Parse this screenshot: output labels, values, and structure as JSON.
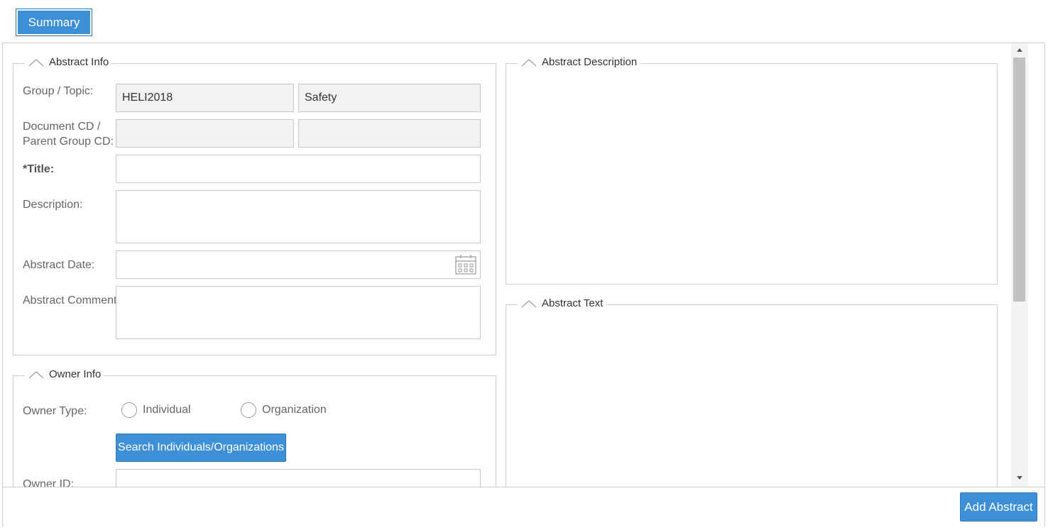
{
  "tabs": {
    "summary": "Summary"
  },
  "abstract_info": {
    "legend": "Abstract Info",
    "group_topic_label": "Group / Topic:",
    "group_value": "HELI2018",
    "topic_value": "Safety",
    "doc_cd_label_1": "Document CD /",
    "doc_cd_label_2": "Parent Group CD:",
    "document_cd_value": "",
    "parent_group_cd_value": "",
    "title_label": "*Title:",
    "title_value": "",
    "description_label": "Description:",
    "description_value": "",
    "abstract_date_label": "Abstract Date:",
    "abstract_date_value": "",
    "abstract_comment_label": "Abstract Comment:",
    "abstract_comment_value": ""
  },
  "owner_info": {
    "legend": "Owner Info",
    "owner_type_label": "Owner Type:",
    "option_individual": "Individual",
    "option_organization": "Organization",
    "search_button": "Search Individuals/Organizations",
    "owner_id_label": "Owner ID:",
    "owner_id_value": ""
  },
  "abstract_description": {
    "legend": "Abstract Description"
  },
  "abstract_text": {
    "legend": "Abstract Text"
  },
  "footer": {
    "add_button": "Add Abstract"
  },
  "colors": {
    "accent": "#3d8fd6",
    "readonly_bg": "#f2f2f2"
  },
  "icons": [
    "chevron-up-icon",
    "calendar-icon",
    "scroll-up-arrow-icon",
    "scroll-down-arrow-icon"
  ]
}
